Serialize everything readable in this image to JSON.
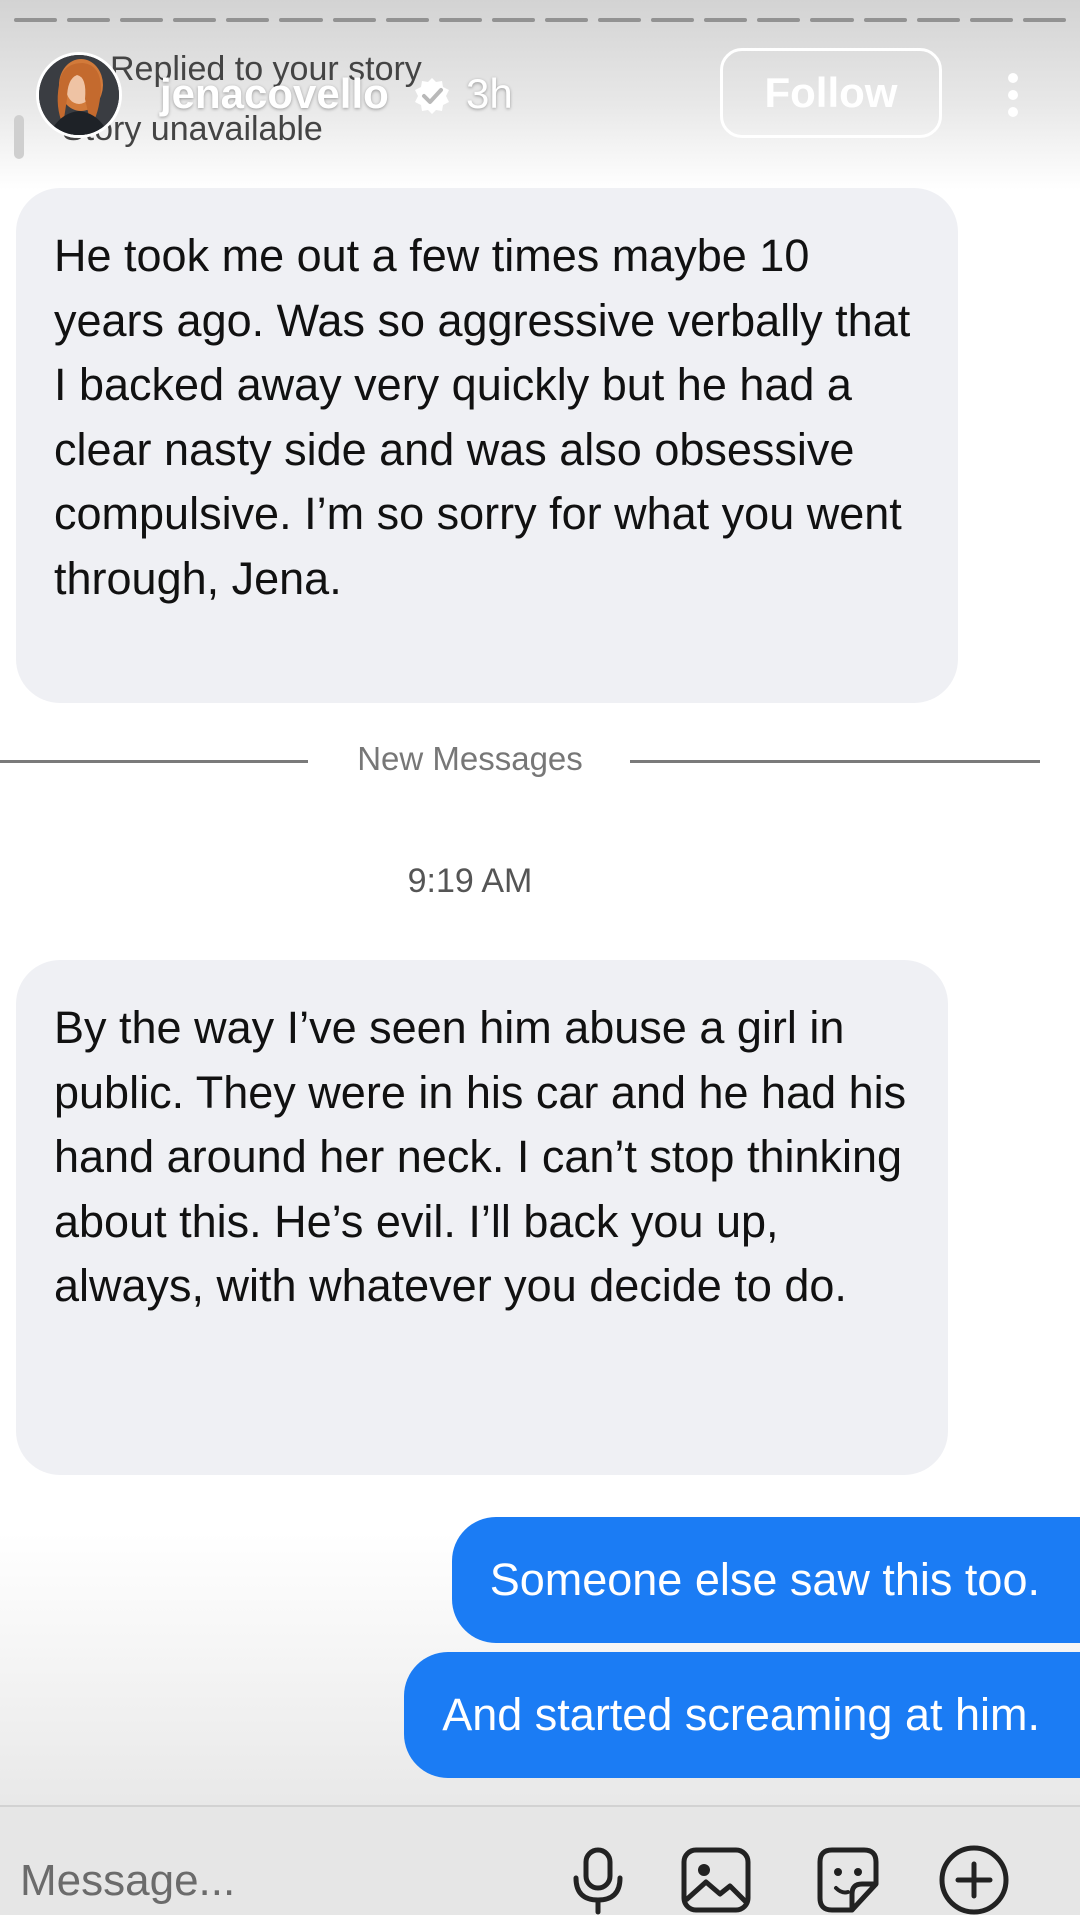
{
  "story_progress": {
    "segments": 20
  },
  "header": {
    "reply_context": "Replied to your story",
    "username": "jenacovello",
    "time_ago": "3h",
    "story_status": "Story unavailable",
    "follow_label": "Follow",
    "avatar_icon": "profile-photo",
    "verified_icon": "verified-badge-icon",
    "more_icon": "more-vertical-icon"
  },
  "messages": [
    {
      "direction": "incoming",
      "text": "He took me out a few times maybe 10 years ago. Was so aggressive verbally that I backed away very quickly but he had a clear nasty side and was also obsessive compulsive. I’m so sorry for what you went through, Jena."
    },
    {
      "direction": "incoming",
      "text": "By the way I’ve seen him abuse a girl in public. They were in his car and he had his hand around her neck. I can’t stop thinking about this. He’s evil. I’ll back you up, always, with whatever you decide to do."
    },
    {
      "direction": "outgoing",
      "text": "Someone else saw this too."
    },
    {
      "direction": "outgoing",
      "text": "And started screaming at him."
    }
  ],
  "divider": {
    "label": "New Messages"
  },
  "timestamp": "9:19 AM",
  "composer": {
    "placeholder": "Message...",
    "icons": [
      "microphone-icon",
      "gallery-icon",
      "sticker-icon",
      "add-icon"
    ]
  },
  "colors": {
    "incoming_bubble": "#eff0f4",
    "outgoing_bubble": "#1b7cf4",
    "verified": "#3897f0"
  }
}
